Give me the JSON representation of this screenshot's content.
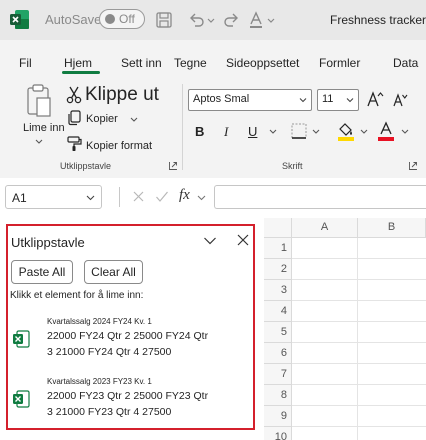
{
  "titlebar": {
    "autosave_label": "AutoSave",
    "autosave_state": "Off",
    "doc_title": "Freshness tracker"
  },
  "tabs": [
    {
      "label": "Fil"
    },
    {
      "label": "Hjem"
    },
    {
      "label": "Sett inn"
    },
    {
      "label": "Tegne"
    },
    {
      "label": "Sideoppsettet"
    },
    {
      "label": "Formler"
    },
    {
      "label": "Data"
    }
  ],
  "ribbon": {
    "clipboard": {
      "paste_label": "Lime inn",
      "cut_label": "Klippe ut",
      "copy_label": "Kopier",
      "format_painter_label": "Kopier format",
      "group_label": "Utklippstavle"
    },
    "font": {
      "font_name": "Aptos Smal",
      "font_size": "11",
      "group_label": "Skrift",
      "bold": "B",
      "italic": "I",
      "underline": "U",
      "fill_color": "#ffd800",
      "font_color": "#e81123"
    }
  },
  "formula_bar": {
    "name_box": "A1",
    "fx_label": "fx",
    "value": ""
  },
  "grid": {
    "columns": [
      "A",
      "B"
    ],
    "rows": [
      "1",
      "2",
      "3",
      "4",
      "5",
      "6",
      "7",
      "8",
      "9",
      "10"
    ]
  },
  "clipboard_pane": {
    "title": "Utklippstavle",
    "paste_all": "Paste All",
    "clear_all": "Clear All",
    "hint": "Klikk et element for å lime inn:",
    "items": [
      {
        "header": "Kvartalssalg 2024 FY24 Kv. 1",
        "line1": "22000 FY24 Qtr 2 25000 FY24 Qtr",
        "line2": "3 21000 FY24 Qtr 4 27500"
      },
      {
        "header": "Kvartalssalg 2023 FY23 Kv. 1",
        "line1": "22000 FY23 Qtr 2 25000 FY23 Qtr",
        "line2": "3 21000 FY23 Qtr 4 27500"
      }
    ]
  },
  "colors": {
    "excel_green": "#107c41",
    "highlight_border": "#d4202c"
  }
}
